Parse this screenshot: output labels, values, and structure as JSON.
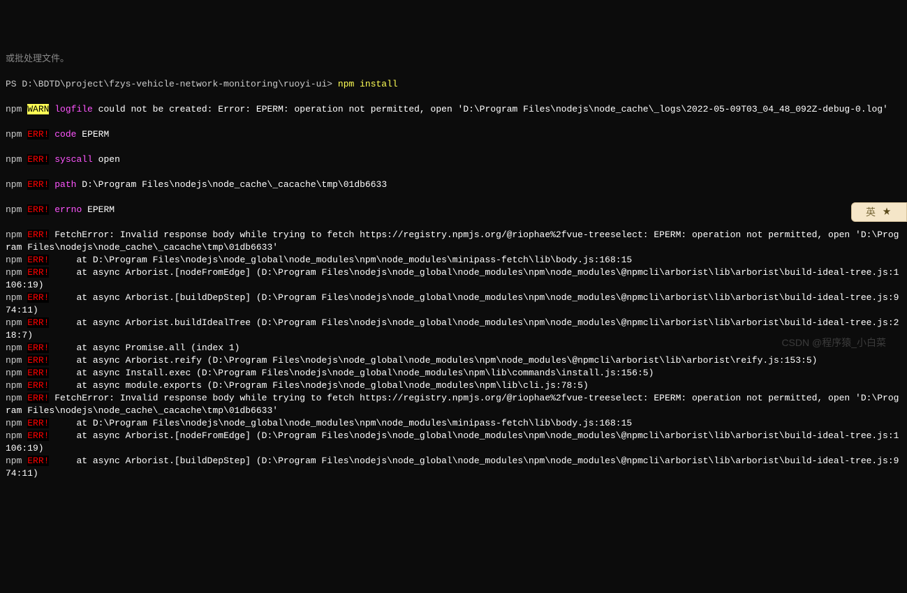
{
  "partial_top": "或批处理文件。",
  "prompt": "PS D:\\BDTD\\project\\fzys-vehicle-network-monitoring\\ruoyi-ui> ",
  "command": "npm install",
  "npm_label": "npm",
  "warn_label": "WARN",
  "err_label": "ERR!",
  "warn_logfile_key": "logfile",
  "warn_line": " could not be created: Error: EPERM: operation not permitted, open 'D:\\Program Files\\nodejs\\node_cache\\_logs\\2022-05-09T03_04_48_092Z-debug-0.log'",
  "err_code_key": "code",
  "err_code_val": " EPERM",
  "err_syscall_key": "syscall",
  "err_syscall_val": " open",
  "err_path_key": "path",
  "err_path_val": " D:\\Program Files\\nodejs\\node_cache\\_cacache\\tmp\\01db6633",
  "err_errno_key": "errno",
  "err_errno_val": " EPERM",
  "err_lines": [
    " FetchError: Invalid response body while trying to fetch https://registry.npmjs.org/@riophae%2fvue-treeselect: EPERM: operation not permitted, open 'D:\\Program Files\\nodejs\\node_cache\\_cacache\\tmp\\01db6633'",
    "     at D:\\Program Files\\nodejs\\node_global\\node_modules\\npm\\node_modules\\minipass-fetch\\lib\\body.js:168:15",
    "     at async Arborist.[nodeFromEdge] (D:\\Program Files\\nodejs\\node_global\\node_modules\\npm\\node_modules\\@npmcli\\arborist\\lib\\arborist\\build-ideal-tree.js:1106:19)",
    "     at async Arborist.[buildDepStep] (D:\\Program Files\\nodejs\\node_global\\node_modules\\npm\\node_modules\\@npmcli\\arborist\\lib\\arborist\\build-ideal-tree.js:974:11)",
    "     at async Arborist.buildIdealTree (D:\\Program Files\\nodejs\\node_global\\node_modules\\npm\\node_modules\\@npmcli\\arborist\\lib\\arborist\\build-ideal-tree.js:218:7)",
    "     at async Promise.all (index 1)",
    "     at async Arborist.reify (D:\\Program Files\\nodejs\\node_global\\node_modules\\npm\\node_modules\\@npmcli\\arborist\\lib\\arborist\\reify.js:153:5)",
    "     at async Install.exec (D:\\Program Files\\nodejs\\node_global\\node_modules\\npm\\lib\\commands\\install.js:156:5)",
    "     at async module.exports (D:\\Program Files\\nodejs\\node_global\\node_modules\\npm\\lib\\cli.js:78:5)",
    " FetchError: Invalid response body while trying to fetch https://registry.npmjs.org/@riophae%2fvue-treeselect: EPERM: operation not permitted, open 'D:\\Program Files\\nodejs\\node_cache\\_cacache\\tmp\\01db6633'",
    "     at D:\\Program Files\\nodejs\\node_global\\node_modules\\npm\\node_modules\\minipass-fetch\\lib\\body.js:168:15",
    "     at async Arborist.[nodeFromEdge] (D:\\Program Files\\nodejs\\node_global\\node_modules\\npm\\node_modules\\@npmcli\\arborist\\lib\\arborist\\build-ideal-tree.js:1106:19)",
    "     at async Arborist.[buildDepStep] (D:\\Program Files\\nodejs\\node_global\\node_modules\\npm\\node_modules\\@npmcli\\arborist\\lib\\arborist\\build-ideal-tree.js:974:11)"
  ],
  "badge_text": "英",
  "watermark": "CSDN @程序猿_小白菜"
}
